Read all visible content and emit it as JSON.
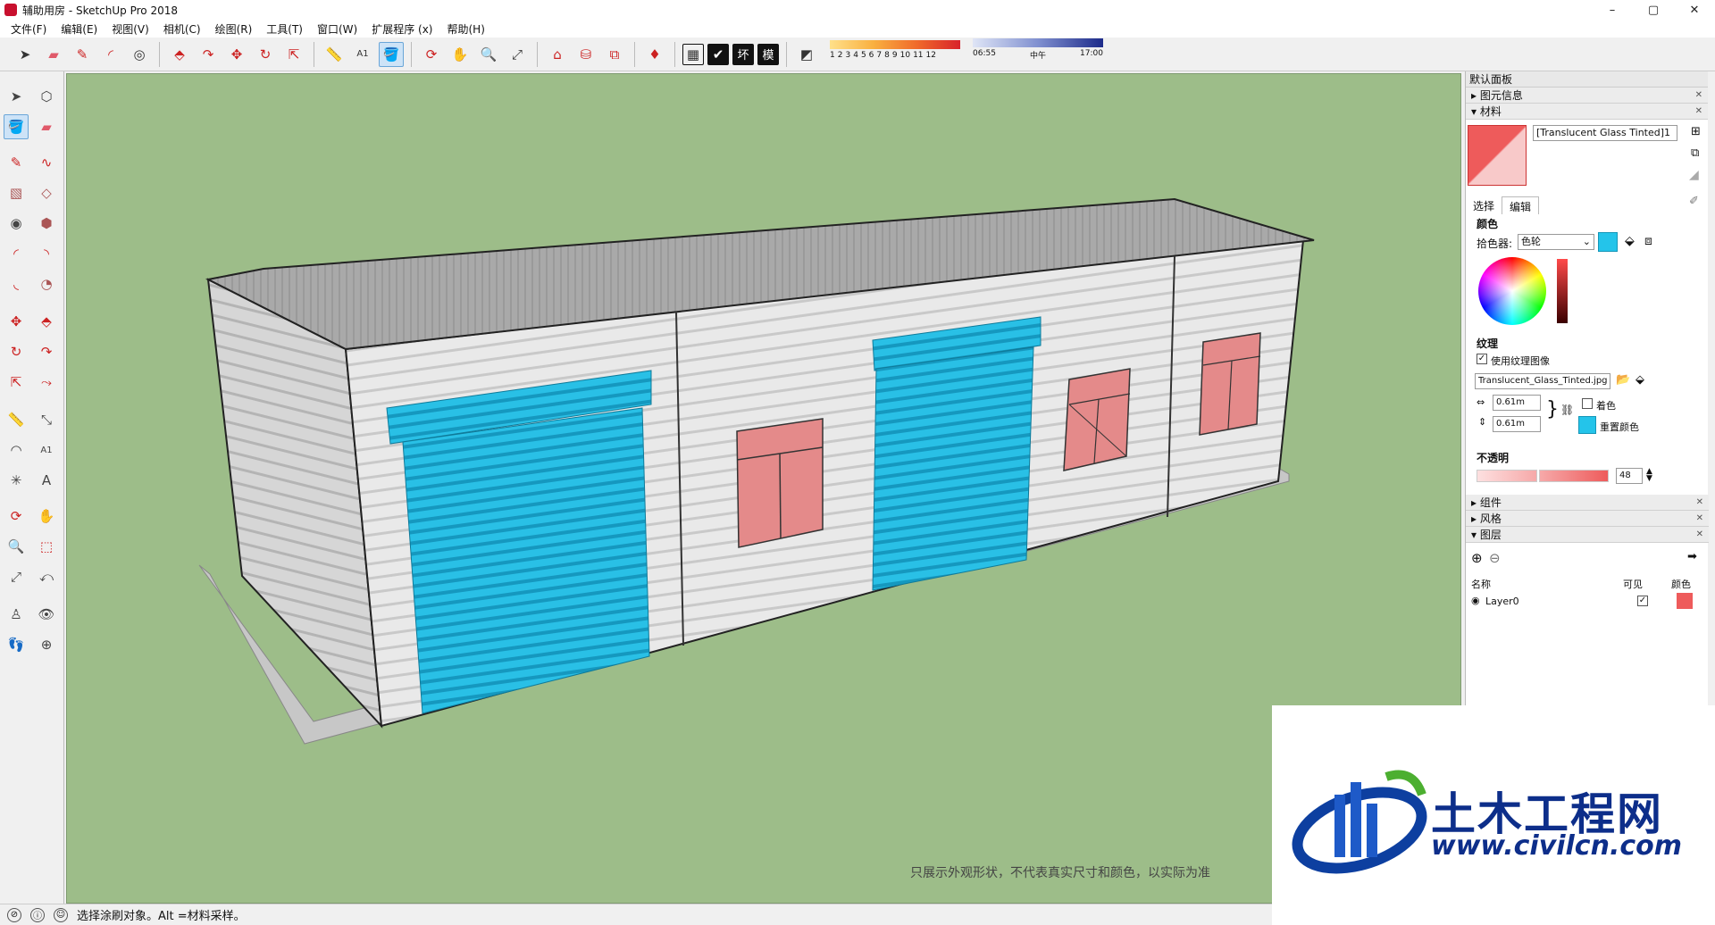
{
  "window": {
    "title": "辅助用房 - SketchUp Pro 2018",
    "minimize": "–",
    "maximize": "▢",
    "close": "✕"
  },
  "menu": [
    "文件(F)",
    "编辑(E)",
    "视图(V)",
    "相机(C)",
    "绘图(R)",
    "工具(T)",
    "窗口(W)",
    "扩展程序 (x)",
    "帮助(H)"
  ],
  "toolbar": {
    "text_buttons": [
      "坏",
      "模"
    ],
    "shadow_months": [
      "1",
      "2",
      "3",
      "4",
      "5",
      "6",
      "7",
      "8",
      "9",
      "10",
      "11",
      "12"
    ],
    "time_labels": [
      "06:55",
      "中午",
      "17:00"
    ]
  },
  "viewport": {
    "disclaimer": "只展示外观形状，不代表真实尺寸和颜色，以实际为准"
  },
  "tray": {
    "title": "默认面板",
    "sections": {
      "entity_info": "图元信息",
      "materials": "材料",
      "components": "组件",
      "styles": "风格",
      "layers": "图层"
    },
    "material": {
      "name": "[Translucent Glass Tinted]1",
      "tab_select": "选择",
      "tab_edit": "编辑",
      "color_label": "颜色",
      "picker_label": "拾色器:",
      "picker_value": "色轮",
      "texture_label": "纹理",
      "use_texture": "使用纹理图像",
      "texture_file": "Translucent_Glass_Tinted.jpg",
      "width": "0.61m",
      "height": "0.61m",
      "colorize": "着色",
      "reset_color": "重置颜色",
      "opacity_label": "不透明",
      "opacity_value": "48",
      "swatch_color": "#ee5b5b",
      "cyan_color": "#24c4ea"
    },
    "layers": {
      "col_name": "名称",
      "col_visible": "可见",
      "col_color": "颜色",
      "rows": [
        {
          "name": "Layer0",
          "visible": "✓",
          "color": "#ee5b5b"
        }
      ]
    }
  },
  "status": {
    "text": "选择涂刷对象。Alt =材料采样。"
  },
  "watermark": {
    "title": "土木工程网",
    "url": "www.civilcn.com"
  }
}
